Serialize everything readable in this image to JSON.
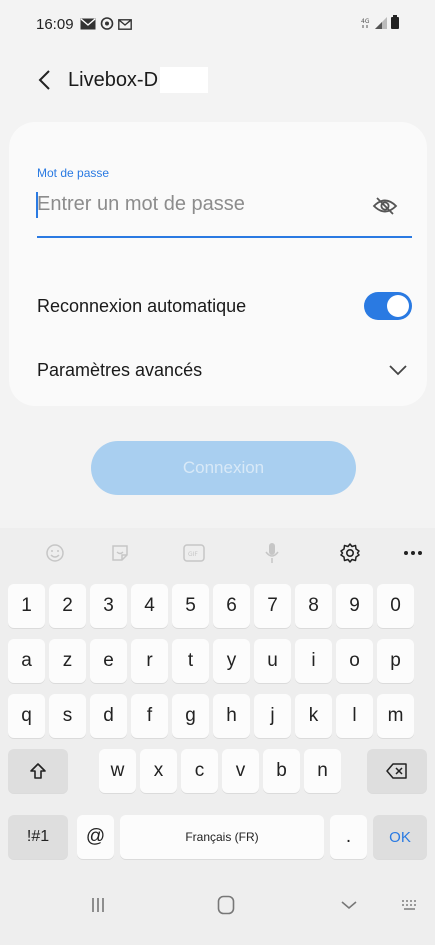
{
  "status_bar": {
    "time": "16:09",
    "notification_icons": [
      "mail-icon",
      "chat-bubble-icon",
      "gmail-icon"
    ],
    "system_icons": [
      "data-icon",
      "signal-icon",
      "battery-icon"
    ]
  },
  "header": {
    "title": "Livebox-D"
  },
  "password": {
    "label": "Mot de passe",
    "value": "",
    "placeholder": "Entrer un mot de passe"
  },
  "auto_reconnect": {
    "label": "Reconnexion automatique",
    "enabled": true
  },
  "advanced": {
    "label": "Paramètres avancés"
  },
  "connect": {
    "label": "Connexion",
    "enabled": false
  },
  "keyboard": {
    "toolbar_icons": [
      "emoji-icon",
      "sticker-icon",
      "gif-icon",
      "microphone-icon",
      "settings-icon",
      "more-icon"
    ],
    "row_numbers": [
      "1",
      "2",
      "3",
      "4",
      "5",
      "6",
      "7",
      "8",
      "9",
      "0"
    ],
    "row_1": [
      "a",
      "z",
      "e",
      "r",
      "t",
      "y",
      "u",
      "i",
      "o",
      "p"
    ],
    "row_2": [
      "q",
      "s",
      "d",
      "f",
      "g",
      "h",
      "j",
      "k",
      "l",
      "m"
    ],
    "row_3": [
      "w",
      "x",
      "c",
      "v",
      "b",
      "n"
    ],
    "symbols_key": "!#1",
    "at_key": "@",
    "space_label": "Français (FR)",
    "period_key": ".",
    "ok_key": "OK"
  },
  "nav_bar": {
    "icons": [
      "recents-icon",
      "home-icon",
      "back-icon",
      "keyboard-toggle-icon"
    ]
  },
  "colors": {
    "accent": "#2a7ae2",
    "button_disabled": "#a9cff0",
    "background": "#f3f3f3",
    "card": "#fafafa"
  }
}
